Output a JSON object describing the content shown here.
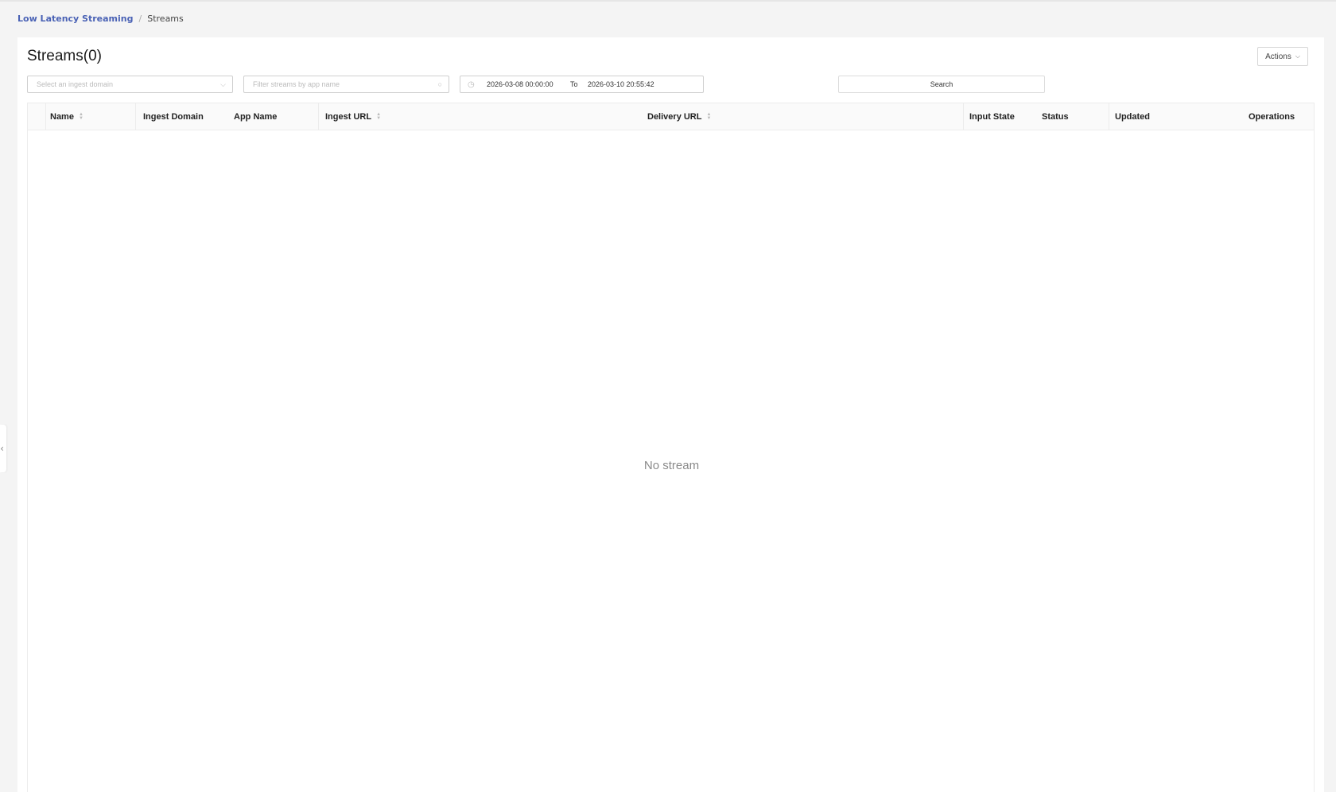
{
  "breadcrumb": {
    "parent": "Low Latency Streaming",
    "separator": "/",
    "current": "Streams"
  },
  "page": {
    "title": "Streams(0)",
    "actions_label": "Actions"
  },
  "filters": {
    "domain_placeholder": "Select an ingest domain",
    "app_placeholder": "Filter streams by app name",
    "date_from": "2026-03-08 00:00:00",
    "date_to_label": "To",
    "date_to": "2026-03-10 20:55:42",
    "search_label": "Search"
  },
  "table": {
    "columns": [
      "Name",
      "Ingest Domain",
      "App Name",
      "Ingest URL",
      "Delivery URL",
      "Input State",
      "Status",
      "Updated",
      "Operations"
    ],
    "rows": [],
    "empty_text": "No stream"
  },
  "icons": {
    "dropdown": "chevron-down-icon",
    "search": "search-icon",
    "calendar": "clock-icon",
    "sort": "sort-icon",
    "collapse": "chevron-left-icon"
  },
  "colors": {
    "link": "#4a62b5",
    "background": "#f4f4f4"
  }
}
